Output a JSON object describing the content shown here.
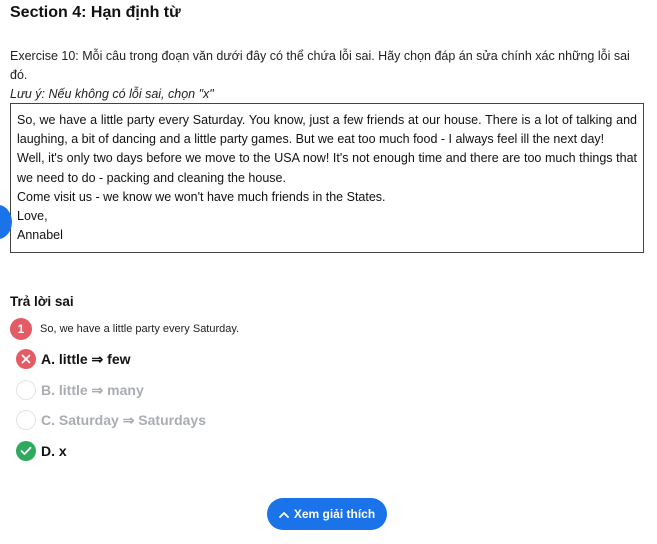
{
  "section": {
    "title": "Section 4: Hạn định từ"
  },
  "exercise": {
    "instruction": "Exercise 10: Mỗi câu trong đoạn văn dưới đây có thể chứa lỗi sai. Hãy chọn đáp án sửa chính xác những lỗi sai đó.",
    "note": "Lưu ý: Nếu không có lỗi sai, chọn \"x\""
  },
  "passage": {
    "lines": [
      "So, we have a little party every Saturday. You know, just a few friends at our house. There is a lot of talking and laughing, a bit of dancing and a little party games. But we eat too much food - I always feel ill the next day!",
      "Well, it's only two days before we move to the USA now! It's not enough time and there are too much things that we need to do - packing and cleaning the house.",
      "Come visit us - we know we won't have much friends in the States.",
      "Love,",
      "Annabel"
    ]
  },
  "answer": {
    "title": "Trả lời sai",
    "question_number": "1",
    "question_text": "So, we have a little party every Saturday.",
    "options": [
      {
        "label": "A. little ⇒ few",
        "state": "wrong"
      },
      {
        "label": "B. little ⇒ many",
        "state": "unselected"
      },
      {
        "label": "C. Saturday ⇒ Saturdays",
        "state": "unselected"
      },
      {
        "label": "D. x",
        "state": "correct"
      }
    ]
  },
  "explain_button": {
    "label": "Xem giải thích",
    "icon": "chevron-up-icon"
  },
  "colors": {
    "accent": "#1a73e8",
    "wrong": "#e45b63",
    "correct": "#2eaa5c",
    "muted": "#a9adb3"
  }
}
